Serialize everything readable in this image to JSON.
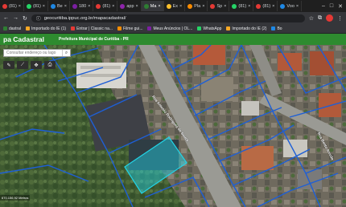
{
  "browser": {
    "tabs": [
      {
        "label": "(81)",
        "color": "#e53935"
      },
      {
        "label": "(81)",
        "color": "#25d366"
      },
      {
        "label": "Be",
        "color": "#1e88e5"
      },
      {
        "label": "180",
        "color": "#7b1fa2"
      },
      {
        "label": "(81)",
        "color": "#e53935"
      },
      {
        "label": "app",
        "color": "#8e24aa"
      },
      {
        "label": "Ma",
        "color": "#2e7d32",
        "active": true
      },
      {
        "label": "Ex",
        "color": "#fbc02d"
      },
      {
        "label": "Pla",
        "color": "#fb8c00"
      },
      {
        "label": "Sp",
        "color": "#e53935"
      },
      {
        "label": "(81)",
        "color": "#25d366"
      },
      {
        "label": "(81)",
        "color": "#e53935"
      },
      {
        "label": "Voo",
        "color": "#1e88e5"
      }
    ],
    "url": "geocuritiba.ippuc.org.br/mapacadastral/",
    "bookmarks": [
      {
        "label": "dastral",
        "color": "#2e7d32"
      },
      {
        "label": "Importado do IE (1)",
        "color": "#f9a825"
      },
      {
        "label": "Entrar | Classic na...",
        "color": "#e53935"
      },
      {
        "label": "Filme gui...",
        "color": "#fb8c00"
      },
      {
        "label": "Meus Anúncios | OL...",
        "color": "#7b1fa2"
      },
      {
        "label": "WhatsApp",
        "color": "#25d366"
      },
      {
        "label": "Importado do IE (2)",
        "color": "#f9a825"
      },
      {
        "label": "Bo",
        "color": "#1e88e5"
      }
    ]
  },
  "app": {
    "title": "pa Cadastral",
    "subtitle": "Prefeitura Municipal de Curitiba - PR",
    "search_placeholder": "Consultar endereço ou lago",
    "street_labels": [
      "Rua Antonio Rodrigues de Souza",
      "Rua Bento Arruda"
    ],
    "scale_text": "670.156,92 Metros"
  },
  "colors": {
    "header_green": "#2e8b2f",
    "parcel_blue": "#1e5fd6",
    "highlight_cyan": "#22d3e6"
  }
}
